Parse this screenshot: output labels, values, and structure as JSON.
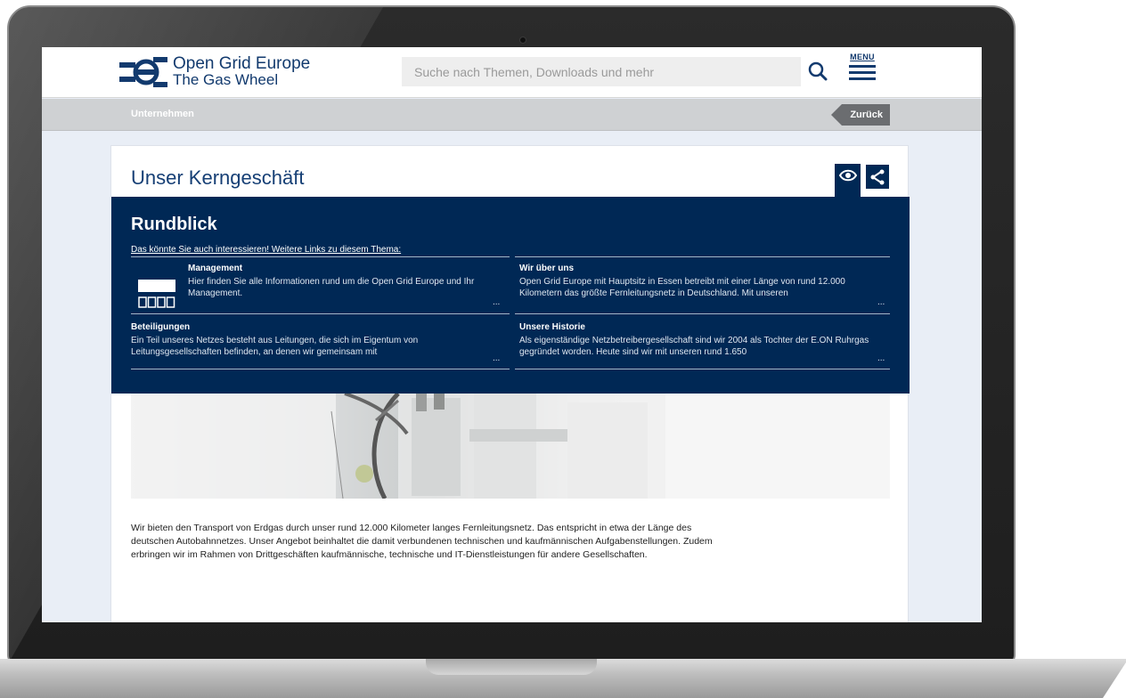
{
  "header": {
    "logo_line1": "Open Grid Europe",
    "logo_line2": "The Gas Wheel",
    "search_placeholder": "Suche nach Themen, Downloads und mehr",
    "menu_label": "MENU"
  },
  "breadcrumb": {
    "current": "Unternehmen",
    "back_label": "Zurück"
  },
  "page": {
    "title": "Unser Kerngeschäft"
  },
  "rundblick": {
    "title": "Rundblick",
    "subtitle": "Das könnte Sie auch interessieren! Weitere Links zu diesem Thema:",
    "more": "...",
    "items": [
      {
        "title": "Management",
        "text": "Hier finden Sie alle Informationen rund um die Open Grid Europe und Ihr Management."
      },
      {
        "title": "Wir über uns",
        "text": "Open Grid Europe mit Hauptsitz in Essen betreibt mit einer Länge von rund 12.000 Kilometern das größte Fernleitungsnetz in Deutschland. Mit unseren"
      },
      {
        "title": "Beteiligungen",
        "text": "Ein Teil unseres Netzes besteht aus Leitungen, die sich im Eigentum von Leitungsgesellschaften befinden, an denen wir gemeinsam mit"
      },
      {
        "title": "Unsere Historie",
        "text": "Als eigenständige Netzbetreibergesellschaft sind wir 2004 als Tochter der E.ON Ruhrgas gegründet worden. Heute sind wir mit unseren rund 1.650"
      }
    ]
  },
  "content": {
    "body": "Wir bieten den Transport von Erdgas durch unser rund 12.000 Kilometer langes Fernleitungsnetz. Das entspricht in etwa der Länge des deutschen Autobahnnetzes. Unser Angebot beinhaltet die damit verbundenen technischen und kaufmännischen Aufgabenstellungen. Zudem erbringen wir im Rahmen von Drittgeschäften kaufmännische, technische und IT-Dienstleistungen für andere Gesellschaften."
  },
  "colors": {
    "brand_navy": "#002855",
    "brand_blue": "#123a6e",
    "breadcrumb_bar": "#cfd1d3",
    "back_button": "#6b6d70"
  },
  "icons": [
    "logo-gas-wheel-icon",
    "search-icon",
    "menu-icon",
    "eye-icon",
    "share-icon",
    "management-icon"
  ]
}
